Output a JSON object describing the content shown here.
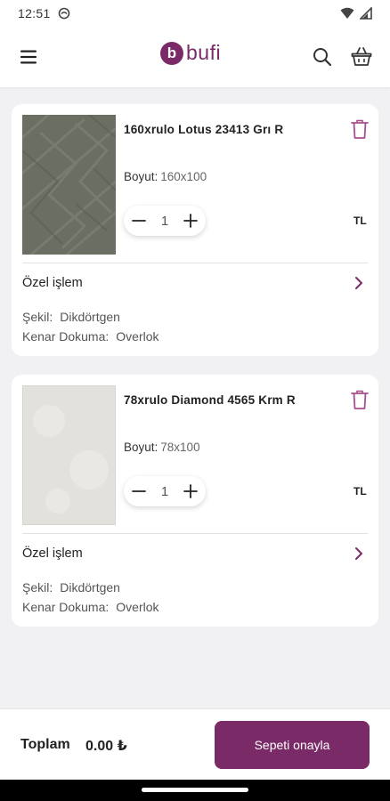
{
  "status_bar": {
    "time": "12:51"
  },
  "header": {
    "logo_mark": "b",
    "logo_word": "bufi"
  },
  "cart": {
    "items": [
      {
        "title": "160xrulo Lotus 23413 Grı R",
        "size_label": "Boyut:",
        "size_value": "160x100",
        "quantity": "1",
        "currency": "TL",
        "special_label": "Özel işlem",
        "shape_label": "Şekil:",
        "shape_value": "Dikdörtgen",
        "edge_label": "Kenar Dokuma:",
        "edge_value": "Overlok",
        "image_color": "#6b6e62"
      },
      {
        "title": "78xrulo Diamond 4565 Krm R",
        "size_label": "Boyut:",
        "size_value": "78x100",
        "quantity": "1",
        "currency": "TL",
        "special_label": "Özel işlem",
        "shape_label": "Şekil:",
        "shape_value": "Dikdörtgen",
        "edge_label": "Kenar Dokuma:",
        "edge_value": "Overlok",
        "image_color": "#e3e1dc"
      }
    ]
  },
  "footer": {
    "total_label": "Toplam",
    "total_value": "0.00 ₺",
    "confirm_label": "Sepeti onayla"
  },
  "colors": {
    "brand": "#7b2a68",
    "background": "#f1f1f3"
  },
  "icons": [
    "menu-icon",
    "search-icon",
    "basket-icon",
    "trash-icon",
    "minus-icon",
    "plus-icon",
    "chevron-right-icon"
  ]
}
